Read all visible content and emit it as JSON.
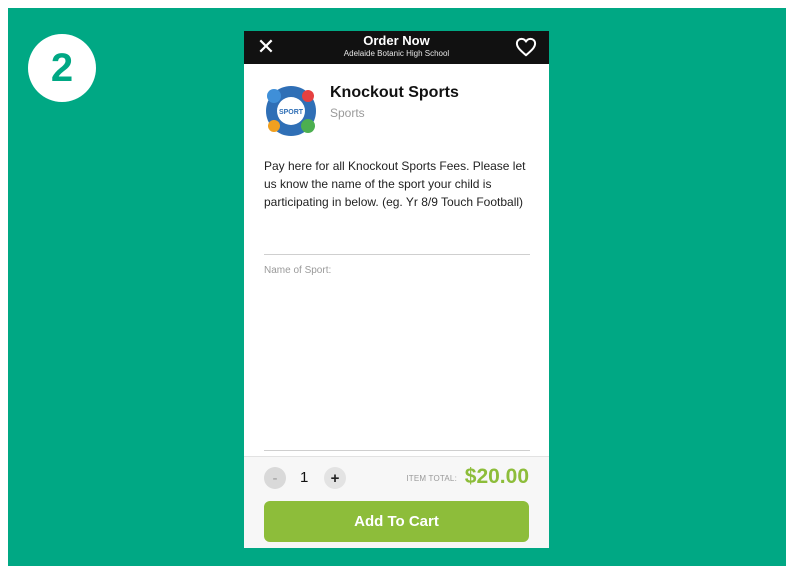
{
  "step": {
    "number": "2"
  },
  "topbar": {
    "title": "Order Now",
    "subtitle": "Adelaide Botanic High School",
    "close_icon": "close-icon",
    "favorite_icon": "heart-icon"
  },
  "vendor": {
    "logo_text": "SPORT",
    "name": "Knockout Sports",
    "category": "Sports"
  },
  "description": "Pay here for all Knockout Sports Fees. Please let us know the name of the sport your child is participating in below. (eg. Yr 8/9 Touch Football)",
  "form": {
    "sport_label": "Name of Sport:",
    "sport_value": ""
  },
  "footer": {
    "minus_label": "-",
    "quantity": "1",
    "plus_label": "+",
    "total_label": "ITEM TOTAL:",
    "total_value": "$20.00",
    "add_to_cart": "Add To Cart"
  },
  "colors": {
    "background": "#00a884",
    "accent": "#8dbd3a",
    "topbar": "#111111"
  }
}
